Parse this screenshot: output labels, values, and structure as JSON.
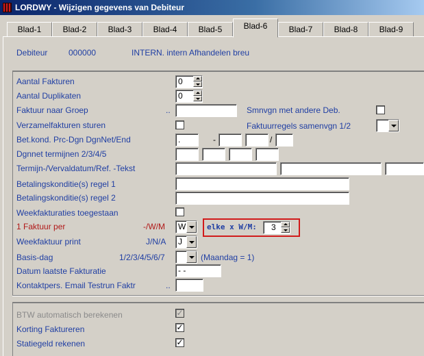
{
  "window": {
    "title": "LORDWY - Wijzigen gegevens van Debiteur"
  },
  "tabs": [
    "Blad-1",
    "Blad-2",
    "Blad-3",
    "Blad-4",
    "Blad-5",
    "Blad-6",
    "Blad-7",
    "Blad-8",
    "Blad-9"
  ],
  "active_tab": "Blad-6",
  "header": {
    "debiteur_label": "Debiteur",
    "debiteur_code": "000000",
    "debiteur_name": "INTERN. intern Afhandelen breu"
  },
  "form": {
    "aantal_fakturen": {
      "label": "Aantal Fakturen",
      "value": "0"
    },
    "aantal_duplikaten": {
      "label": "Aantal Duplikaten",
      "value": "0"
    },
    "faktuur_naar_groep": {
      "label": "Faktuur naar Groep",
      "hint": "..",
      "value": ""
    },
    "smnvgn": {
      "label": "Smnvgn met andere Deb.",
      "checked": false
    },
    "verzamelfakturen": {
      "label": "Verzamelfakturen sturen",
      "checked": false
    },
    "faktuurregels": {
      "label": "Faktuurregels samenvgn 1/2",
      "value": ""
    },
    "bet_kond": {
      "label": "Bet.kond. Prc-Dgn DgnNet/End",
      "value1": ".",
      "dash": "-",
      "slash": "/"
    },
    "dgnnet": {
      "label": "Dgnnet termijnen 2/3/4/5"
    },
    "termijn": {
      "label": "Termijn-/Vervaldatum/Ref. -Tekst"
    },
    "betaling1": {
      "label": "Betalingskonditie(s) regel 1"
    },
    "betaling2": {
      "label": "Betalingskonditie(s) regel 2"
    },
    "weekfakturaties": {
      "label": "Weekfakturaties toegestaan",
      "checked": false
    },
    "faktuur_per": {
      "label": "1 Faktuur per",
      "hint": "-/W/M",
      "value": "W"
    },
    "elke": {
      "label": "elke x W/M:",
      "value": "3"
    },
    "weekfaktuur_print": {
      "label": "Weekfaktuur print",
      "hint": "J/N/A",
      "value": "J"
    },
    "basis_dag": {
      "label": "Basis-dag",
      "hint": "1/2/3/4/5/6/7",
      "value": "",
      "note": "(Maandag =  1)"
    },
    "datum_laatste": {
      "label": "Datum laatste Fakturatie",
      "value": "- -"
    },
    "kontaktpers": {
      "label": "Kontaktpers. Email Testrun Faktr",
      "hint": "..",
      "value": ""
    }
  },
  "footer": {
    "btw": {
      "label": "BTW automatisch berekenen",
      "checked": true,
      "disabled": true
    },
    "korting": {
      "label": "Korting    Faktureren",
      "checked": true
    },
    "statiegeld": {
      "label": "Statiegeld rekenen",
      "checked": true
    }
  },
  "colors": {
    "label_blue": "#1f3ea3",
    "label_red": "#b01818",
    "highlight_red": "#d11a1a",
    "dialog_gray": "#d4d0c8"
  }
}
